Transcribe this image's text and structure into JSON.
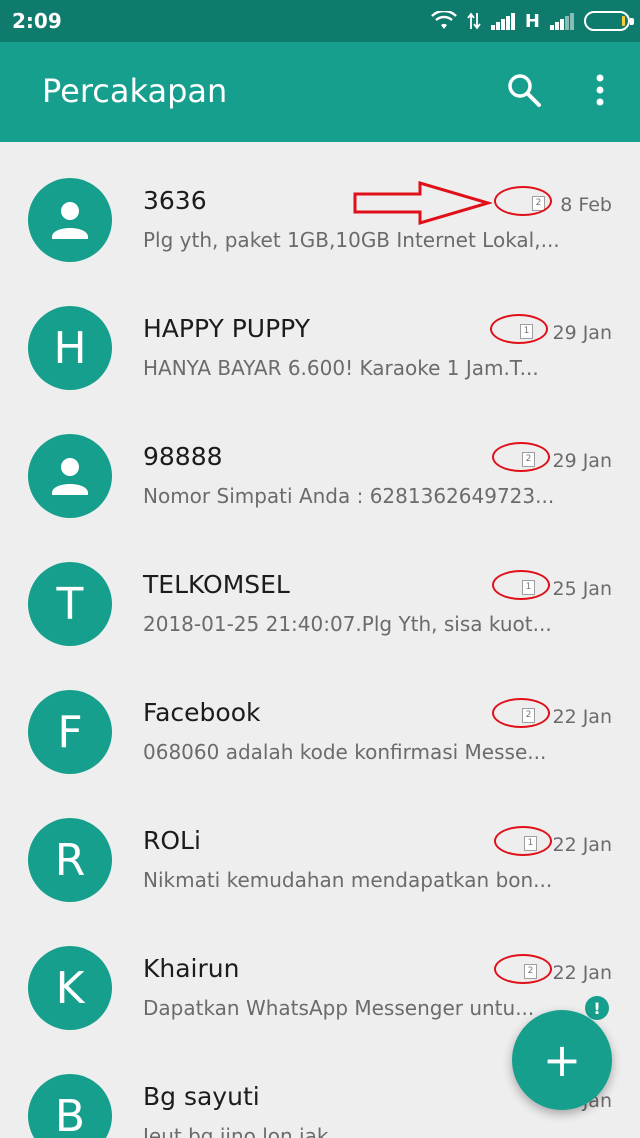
{
  "status_bar": {
    "time": "2:09",
    "network_type": "H",
    "icons": [
      "wifi-icon",
      "data-transfer-icon",
      "signal-icon",
      "signal-icon",
      "battery-icon"
    ]
  },
  "app_bar": {
    "title": "Percakapan",
    "icons": [
      "search-icon",
      "more-vert-icon"
    ]
  },
  "conversations": [
    {
      "avatar_type": "person",
      "avatar_letter": "",
      "name": "3636",
      "preview": "Plg yth, paket 1GB,10GB Internet Lokal,...",
      "sim": "2",
      "date": "8 Feb"
    },
    {
      "avatar_type": "letter",
      "avatar_letter": "H",
      "name": "HAPPY PUPPY",
      "preview": "HANYA BAYAR 6.600! Karaoke 1 Jam.T...",
      "sim": "1",
      "date": "29 Jan"
    },
    {
      "avatar_type": "person",
      "avatar_letter": "",
      "name": "98888",
      "preview": "Nomor Simpati Anda : 6281362649723...",
      "sim": "2",
      "date": "29 Jan"
    },
    {
      "avatar_type": "letter",
      "avatar_letter": "T",
      "name": "TELKOMSEL",
      "preview": "2018-01-25 21:40:07.Plg Yth, sisa kuot...",
      "sim": "1",
      "date": "25 Jan"
    },
    {
      "avatar_type": "letter",
      "avatar_letter": "F",
      "name": "Facebook",
      "preview": "068060 adalah kode konfirmasi Messe...",
      "sim": "2",
      "date": "22 Jan"
    },
    {
      "avatar_type": "letter",
      "avatar_letter": "R",
      "name": "ROLi",
      "preview": "Nikmati kemudahan mendapatkan bon...",
      "sim": "1",
      "date": "22 Jan"
    },
    {
      "avatar_type": "letter",
      "avatar_letter": "K",
      "name": "Khairun",
      "preview": "Dapatkan WhatsApp Messenger untu...",
      "sim": "2",
      "date": "22 Jan",
      "badge": "!"
    },
    {
      "avatar_type": "letter",
      "avatar_letter": "B",
      "name": "Bg sayuti",
      "preview": "Jeut bg jino lon jak",
      "sim": "",
      "date": "Jan"
    }
  ],
  "fab": {
    "label": "+"
  },
  "colors": {
    "status_bar": "#0f7b6d",
    "app_bar": "#169f8d",
    "annotation": "#e0101a",
    "background": "#eeeeee"
  }
}
